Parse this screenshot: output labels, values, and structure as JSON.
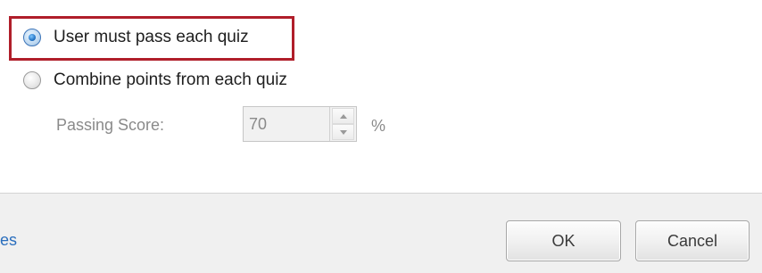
{
  "options": {
    "pass_each_quiz": {
      "label": "User must pass each quiz",
      "selected": true
    },
    "combine_points": {
      "label": "Combine points from each quiz",
      "selected": false
    }
  },
  "passing_score": {
    "label": "Passing Score:",
    "value": "70",
    "unit": "%",
    "enabled": false
  },
  "footer": {
    "link_text": "es",
    "ok_label": "OK",
    "cancel_label": "Cancel"
  },
  "colors": {
    "highlight_border": "#b01e2a",
    "link": "#2a6ebd",
    "footer_bg": "#f0f0f0"
  },
  "icons": {
    "selected_radio": "radio-checked-icon",
    "unselected_radio": "radio-unchecked-icon",
    "spin_up": "spin-up-arrow-icon",
    "spin_down": "spin-down-arrow-icon"
  }
}
